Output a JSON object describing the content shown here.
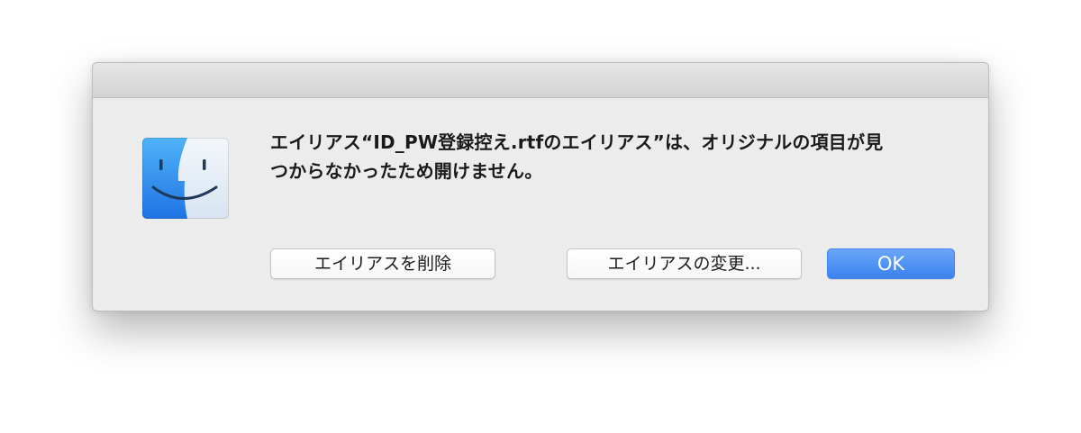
{
  "dialog": {
    "icon": "finder-icon",
    "message_line1": "エイリアス“ID_PW登録控え.rtfのエイリアス”は、オリジナルの項目が見",
    "message_line2": "つからなかったため開けません。",
    "buttons": {
      "delete_label": "エイリアスを削除",
      "change_label": "エイリアスの変更...",
      "ok_label": "OK"
    }
  },
  "colors": {
    "dialog_bg": "#ececec",
    "default_button": "#3b82f0",
    "finder_blue": "#2d8bf2",
    "finder_light": "#e3eef9"
  }
}
